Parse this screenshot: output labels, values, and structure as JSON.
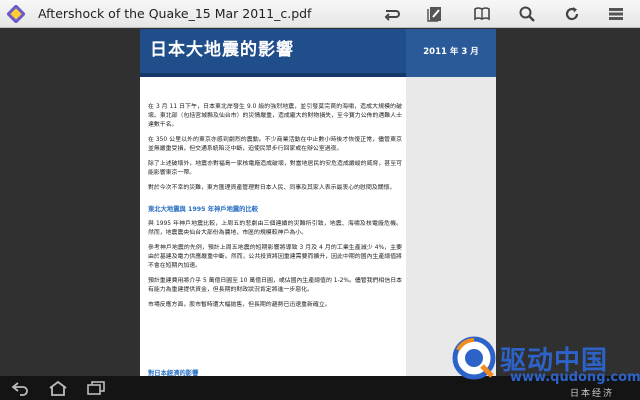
{
  "app": {
    "title": "Aftershock of the Quake_15 Mar 2011_c.pdf"
  },
  "toolbar": {
    "icons": [
      "swap-icon",
      "pen-icon",
      "book-icon",
      "search-icon",
      "refresh-icon",
      "more-icon"
    ]
  },
  "document": {
    "header_title": "日本大地震的影響",
    "header_date": "2011 年 3 月",
    "paragraphs": [
      "在 3 月 11 日下午，日本東北岸發生 9.0 級的強烈地震，並引發莫完苠的海嘯，造成大規模的破壞。東北部（包括宮城縣及仙台市）的災情嚴重，造成龐大的財物損失，至今寶力公佈的遇難人士達數千名。",
      "在 350 公里以外的東京亦感到劇烈的震動。不少商業活動在中止數小時後才恢復正常，儘管東京並無嚴重受損，但交通系統陷泛中斷，迫使民眾步行回家或在辦公室過夜。",
      "除了上述破壞外，地震亦對福島一家核電廠造成破壞，對當地居民的安危造成嚴峻的威脅，甚至可能影響東京一帶。",
      "對於今次不幸的災難，東方匯理資產管理對日本人民、同事及其家人表示最衷心的慰問及關懷。"
    ],
    "subhead_1": "東北大地震與 1995 年神戶地震的比較",
    "paragraphs_2": [
      "與 1995 年神戶地震比較，上周五的悲劇由三個連續的災難所引致，地震、海嘯及核電廠危機。然而，地震震央仙台大部份為農地，市區的規模較神戶為小。",
      "參考神戶地震的先例，預計上周五地震的短期影響將導致 3 月及 4 月的工業生產減少 4%，主要由於基建及電力供應嚴重中斷。然而，公共投資將因重建需要而擴升，因此中期的國內生產總值將不會在短期內加速。",
      "預計重建費用將介乎 5 萬億日圓至 10 萬億日圓，或佔國內生產總值的 1-2%。儘管我們相信日本有能力為重建提供資金，但長期的財政狀況肯定將進一步惡化。",
      "市場反應方面，股市暫時遭大幅拋售，但長期的趨勢已迅速重新確立。"
    ],
    "subhead_2": "對日本經濟的影響"
  },
  "navbar": {
    "icons": [
      "back-icon",
      "home-icon",
      "recent-apps-icon"
    ]
  },
  "watermark": {
    "name": "驱动中国",
    "url": "www.qudong.com",
    "sub": "日本经济"
  },
  "colors": {
    "header_blue": "#1f4e8a",
    "accent_blue": "#2a6fc3",
    "watermark_blue": "#2d63c8"
  }
}
